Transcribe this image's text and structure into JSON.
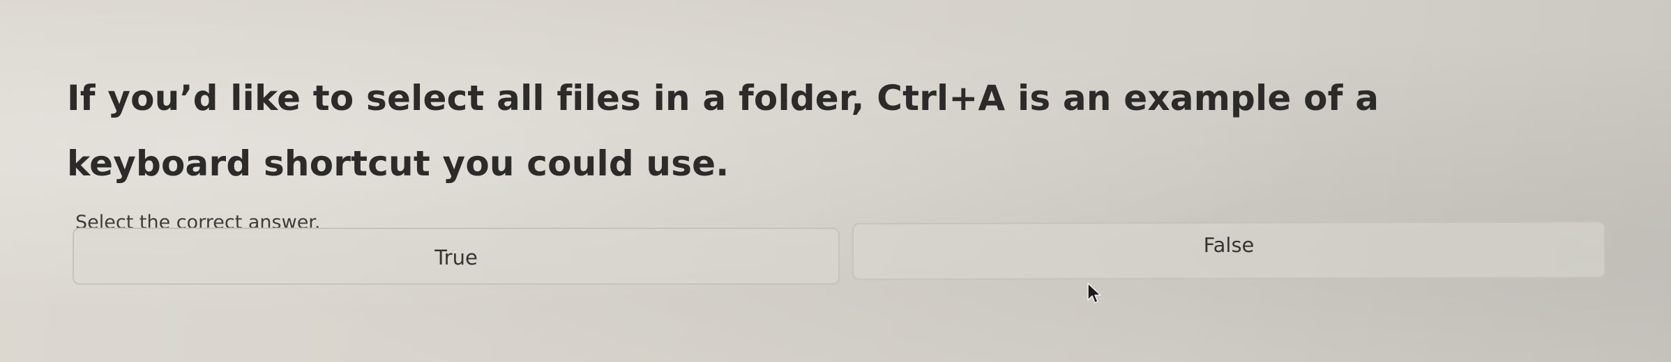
{
  "question": {
    "text": "If you’d like to select all files in a folder, Ctrl+A is an example of a keyboard shortcut you could use.",
    "instruction": "Select the correct answer."
  },
  "answers": [
    {
      "label": "True"
    },
    {
      "label": "False"
    }
  ],
  "colors": {
    "background": "#d8d4cd",
    "text": "#2c2b2a",
    "option_border": "#c6c3bd"
  },
  "icons": {
    "cursor": "mouse-pointer-icon"
  }
}
